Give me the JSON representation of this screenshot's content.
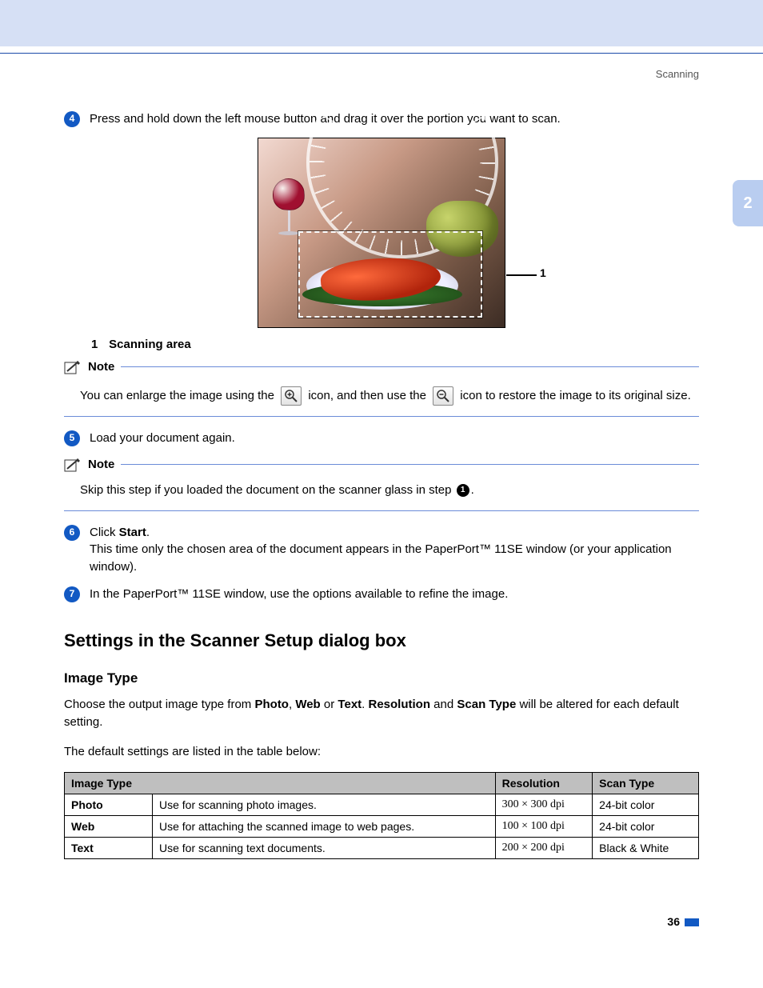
{
  "running_head": "Scanning",
  "chapter_tab": "2",
  "steps": {
    "s4": {
      "num": "4",
      "text": "Press and hold down the left mouse button and drag it over the portion you want to scan."
    },
    "s5": {
      "num": "5",
      "text": "Load your document again."
    },
    "s6": {
      "num": "6",
      "lead": "Click ",
      "bold": "Start",
      "tail": ".",
      "line2": "This time only the chosen area of the document appears in the PaperPort™ 11SE window (or your application window)."
    },
    "s7": {
      "num": "7",
      "text": "In the PaperPort™ 11SE window, use the options available to refine the image."
    }
  },
  "figure": {
    "leader_label": "1",
    "caption_num": "1",
    "caption_text": "Scanning area"
  },
  "note1": {
    "label": "Note",
    "part1": "You can enlarge the image using the ",
    "part2": " icon, and then use the ",
    "part3": " icon to restore the image to its original size."
  },
  "note2": {
    "label": "Note",
    "part1": "Skip this step if you loaded the document on the scanner glass in step ",
    "ref": "1",
    "part2": "."
  },
  "section_heading": "Settings in the Scanner Setup dialog box",
  "sub_heading": "Image Type",
  "para1_a": "Choose the output image type from ",
  "para1_b": "Photo",
  "para1_c": ", ",
  "para1_d": "Web",
  "para1_e": " or ",
  "para1_f": "Text",
  "para1_g": ". ",
  "para1_h": "Resolution",
  "para1_i": " and ",
  "para1_j": "Scan Type",
  "para1_k": " will be altered for each default setting.",
  "para2": "The default settings are listed in the table below:",
  "table": {
    "headers": {
      "c1": "Image Type",
      "c2": "Resolution",
      "c3": "Scan Type"
    },
    "rows": [
      {
        "k": "Photo",
        "desc": "Use for scanning photo images.",
        "res": "300 × 300 dpi",
        "scan": "24-bit color"
      },
      {
        "k": "Web",
        "desc": "Use for attaching the scanned image to web pages.",
        "res": "100 × 100 dpi",
        "scan": "24-bit color"
      },
      {
        "k": "Text",
        "desc": "Use for scanning text documents.",
        "res": "200 × 200 dpi",
        "scan": "Black & White"
      }
    ]
  },
  "page_number": "36"
}
